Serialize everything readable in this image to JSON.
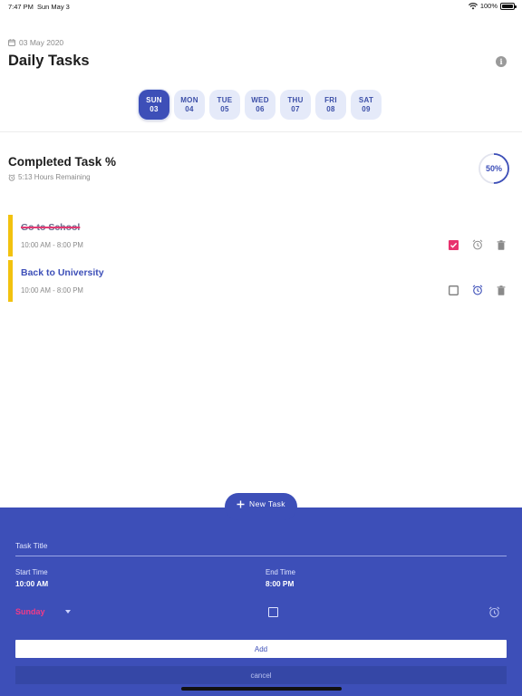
{
  "status_bar": {
    "time": "7:47 PM",
    "date": "Sun May 3",
    "battery": "100%"
  },
  "header": {
    "date": "03 May 2020",
    "title": "Daily Tasks"
  },
  "days": [
    {
      "name": "SUN",
      "num": "03",
      "active": true
    },
    {
      "name": "MON",
      "num": "04",
      "active": false
    },
    {
      "name": "TUE",
      "num": "05",
      "active": false
    },
    {
      "name": "WED",
      "num": "06",
      "active": false
    },
    {
      "name": "THU",
      "num": "07",
      "active": false
    },
    {
      "name": "FRI",
      "num": "08",
      "active": false
    },
    {
      "name": "SAT",
      "num": "09",
      "active": false
    }
  ],
  "progress": {
    "title": "Completed Task %",
    "remaining": "5:13 Hours Remaining",
    "label": "50%",
    "fraction": 0.5
  },
  "tasks": [
    {
      "title": "Go to School",
      "time": "10:00 AM - 8:00 PM",
      "done": true
    },
    {
      "title": "Back to University",
      "time": "10:00 AM - 8:00 PM",
      "done": false
    }
  ],
  "new_task_button": {
    "label": "New Task"
  },
  "form": {
    "title_placeholder": "Task Title",
    "start_label": "Start Time",
    "start_value": "10:00 AM",
    "end_label": "End Time",
    "end_value": "8:00 PM",
    "day": "Sunday",
    "add_label": "Add",
    "cancel_label": "cancel"
  },
  "colors": {
    "primary": "#3d4fb8",
    "accent": "#f03a88",
    "task_bar": "#f2c20f",
    "chip_bg": "#e5eaf9"
  },
  "icons": [
    "wifi-icon",
    "battery-icon",
    "calendar-icon",
    "info-icon",
    "alarm-icon",
    "checkbox-icon",
    "trash-icon",
    "plus-icon",
    "dropdown-caret-icon"
  ]
}
